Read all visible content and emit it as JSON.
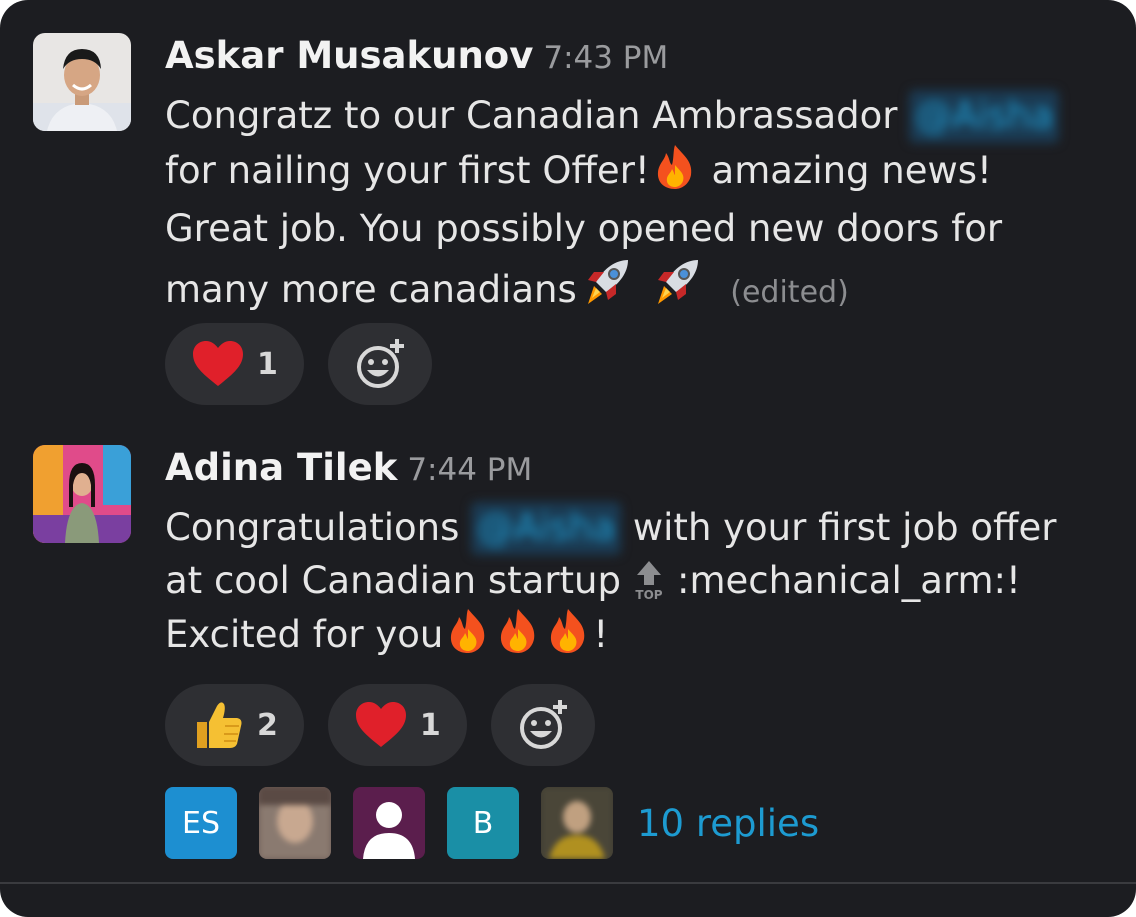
{
  "messages": [
    {
      "author": "Askar Musakunov",
      "time": "7:43 PM",
      "lines": [
        "Congratz to our Canadian Ambrassador",
        "for nailing your first Offer!",
        "amazing news!",
        "Great job. You possibly opened new doors for",
        "many more canadians"
      ],
      "mention": "@Aisha",
      "edited": "(edited)",
      "reactions": [
        {
          "icon": "heart-emoji",
          "count": "1"
        }
      ]
    },
    {
      "author": "Adina Tilek",
      "time": "7:44 PM",
      "lines": [
        "Congratulations",
        "with your first job offer",
        "at cool Canadian startup",
        ":mechanical_arm:!",
        "Excited for you",
        "!"
      ],
      "mention": "@Aisha",
      "reactions": [
        {
          "icon": "thumbs-up-emoji",
          "count": "2"
        },
        {
          "icon": "heart-emoji",
          "count": "1"
        }
      ]
    }
  ],
  "thread": {
    "avatars": [
      {
        "initials": "ES",
        "color": "#1d8fd1"
      },
      {
        "initials": "",
        "color": "#6b5a55"
      },
      {
        "initials": "",
        "color": "#5b1e4d"
      },
      {
        "initials": "B",
        "color": "#1a8fa6"
      },
      {
        "initials": "",
        "color": "#3b3a30"
      }
    ],
    "replies_label": "10 replies"
  },
  "colors": {
    "background": "#1c1d21",
    "link": "#1d9bd1",
    "pill": "#2e2f33"
  }
}
